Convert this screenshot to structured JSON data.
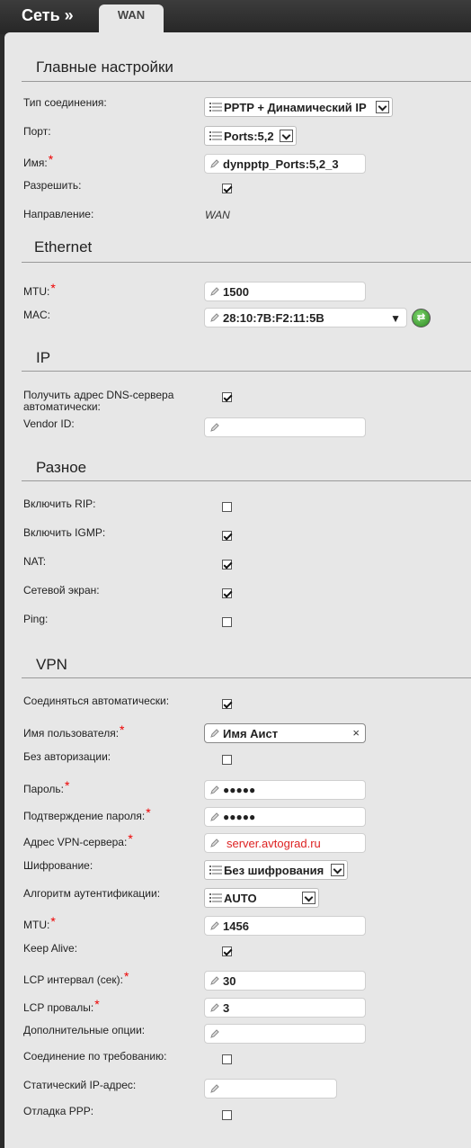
{
  "header": {
    "breadcrumb": "Сеть »",
    "tab": "WAN"
  },
  "main_settings": {
    "title": "Главные настройки",
    "connection_type_label": "Тип соединения:",
    "connection_type_value": "PPTP + Динамический IP",
    "port_label": "Порт:",
    "port_value": "Ports:5,2",
    "name_label": "Имя:",
    "name_value": "dynpptp_Ports:5,2_3",
    "enable_label": "Разрешить:",
    "direction_label": "Направление:",
    "direction_value": "WAN"
  },
  "ethernet": {
    "title": "Ethernet",
    "mtu_label": "MTU:",
    "mtu_value": "1500",
    "mac_label": "MAC:",
    "mac_value": "28:10:7B:F2:11:5B"
  },
  "ip": {
    "title": "IP",
    "dns_label": "Получить адрес DNS-сервера автоматически:",
    "vendor_label": "Vendor ID:",
    "vendor_value": ""
  },
  "misc": {
    "title": "Разное",
    "rip_label": "Включить RIP:",
    "igmp_label": "Включить IGMP:",
    "nat_label": "NAT:",
    "firewall_label": "Сетевой экран:",
    "ping_label": "Ping:"
  },
  "vpn": {
    "title": "VPN",
    "auto_label": "Соединяться автоматически:",
    "username_label": "Имя пользователя:",
    "username_value": "Имя Аист",
    "noauth_label": "Без авторизации:",
    "password_label": "Пароль:",
    "password_value": "●●●●●",
    "confirm_label": "Подтверждение пароля:",
    "confirm_value": "●●●●●",
    "server_label": "Адрес VPN-сервера:",
    "server_value": "server.avtograd.ru",
    "encryption_label": "Шифрование:",
    "encryption_value": "Без шифрования",
    "auth_label": "Алгоритм аутентификации:",
    "auth_value": "AUTO",
    "mtu_label": "MTU:",
    "mtu_value": "1456",
    "keepalive_label": "Keep Alive:",
    "lcp_interval_label": "LCP интервал (сек):",
    "lcp_interval_value": "30",
    "lcp_fails_label": "LCP провалы:",
    "lcp_fails_value": "3",
    "extra_label": "Дополнительные опции:",
    "extra_value": "",
    "on_demand_label": "Соединение по требованию:",
    "static_ip_label": "Статический IP-адрес:",
    "static_ip_value": "",
    "ppp_debug_label": "Отладка PPP:"
  },
  "required_mark": "*",
  "clear_symbol": "×",
  "refresh_symbol": "⇄",
  "dropdown_symbol": "▼",
  "checkboxes": {
    "enable": true,
    "dns_auto": true,
    "rip": false,
    "igmp": true,
    "nat": true,
    "firewall": true,
    "ping": false,
    "auto_connect": true,
    "noauth": false,
    "keepalive": true,
    "on_demand": false,
    "ppp_debug": false
  }
}
